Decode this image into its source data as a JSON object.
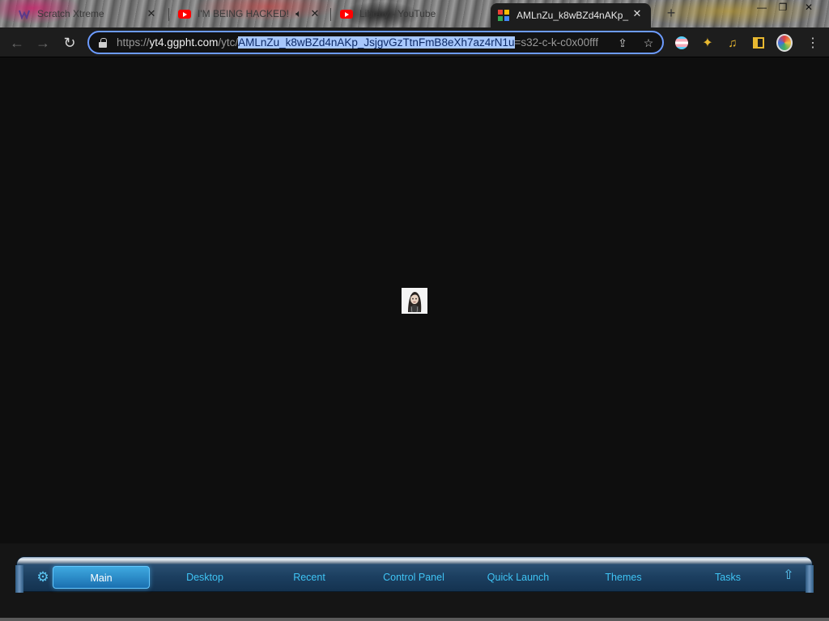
{
  "browser": {
    "tabs": [
      {
        "title": "Scratch Xtreme",
        "favicon": "scratch-icon",
        "active": false
      },
      {
        "title": "I'M BEING HACKED!",
        "favicon": "youtube-icon",
        "active": false,
        "muted_icon": "speaker-icon"
      },
      {
        "title": "Library - YouTube",
        "favicon": "youtube-icon",
        "active": false
      },
      {
        "title": "AMLnZu_k8wBZd4nAKp_",
        "favicon": "image-icon",
        "active": true
      }
    ],
    "new_tab_icon": "plus-icon",
    "window_controls": [
      "minimize-icon",
      "restore-icon",
      "close-icon"
    ],
    "close_glyph": "✕",
    "new_tab_glyph": "+",
    "minimize_glyph": "—",
    "restore_glyph": "❐"
  },
  "toolbar": {
    "back_glyph": "←",
    "forward_glyph": "→",
    "reload_glyph": "↻",
    "url": {
      "scheme": "https://",
      "host": "yt4.ggpht.com",
      "path_pre": "/ytc/",
      "path_selected": "AMLnZu_k8wBZd4nAKp_JsjgvGzTtnFmB8eXh7az4rN1u",
      "path_post": "=s32-c-k-c0x00fff"
    },
    "share_glyph": "⇪",
    "bookmark_glyph": "☆",
    "extension_glyph": "✦",
    "media_glyph": "♫",
    "menu_glyph": "⋮"
  },
  "page": {
    "image_alt": "profile picture",
    "background": "#0e0e0e"
  },
  "dock": {
    "gear_glyph": "⚙",
    "up_glyph": "⇧",
    "items": [
      {
        "label": "Main",
        "active": true
      },
      {
        "label": "Desktop",
        "active": false
      },
      {
        "label": "Recent",
        "active": false
      },
      {
        "label": "Control Panel",
        "active": false
      },
      {
        "label": "Quick Launch",
        "active": false
      },
      {
        "label": "Themes",
        "active": false
      },
      {
        "label": "Tasks",
        "active": false
      }
    ],
    "accent": "#3fc4f5"
  }
}
